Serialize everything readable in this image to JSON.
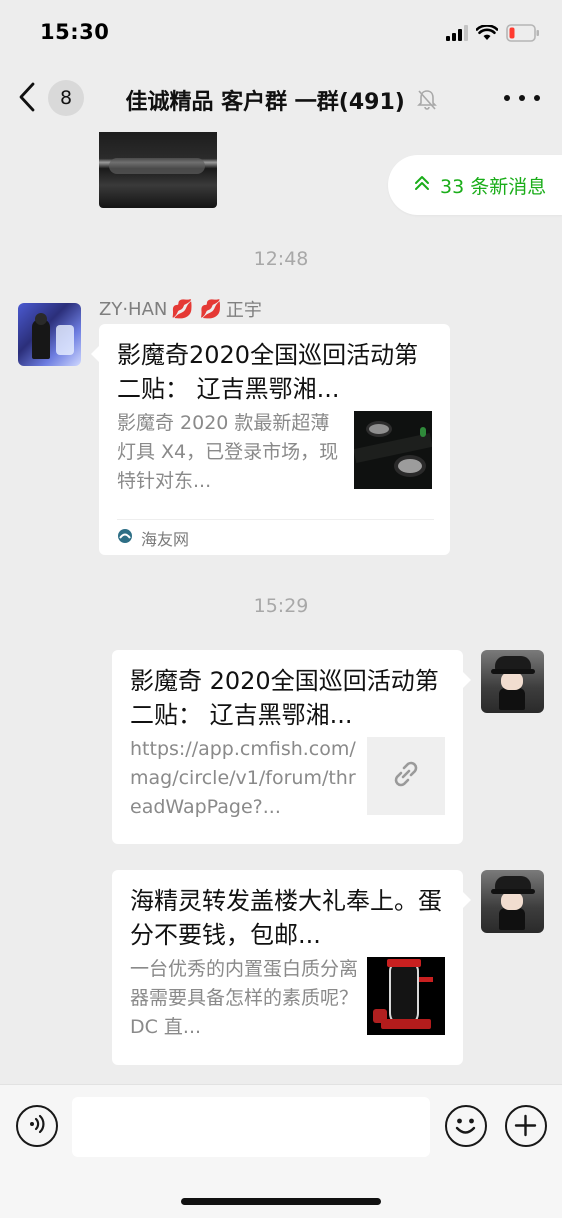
{
  "status_bar": {
    "time": "15:30",
    "icons": [
      "signal-icon",
      "wifi-icon",
      "battery-low-icon"
    ],
    "battery_color": "#ff3b30"
  },
  "nav": {
    "back_count": "8",
    "title": "佳诚精品 客户群 一群(491)",
    "icons": [
      "back-arrow-icon",
      "mute-bell-icon",
      "more-icon"
    ]
  },
  "new_messages": {
    "label": "33 条新消息",
    "icon": "double-chevron-up-icon",
    "color": "#1aad19"
  },
  "messages": {
    "time1": "12:48",
    "time2": "15:29",
    "msg1": {
      "sender_prefix": "ZY·HAN",
      "sender_emoji": "💋 💋",
      "sender_suffix": "正宇",
      "title": "影魔奇2020全国巡回活动第二贴： 辽吉黑鄂湘...",
      "description": "影魔奇 2020 款最新超薄灯具 X4，已登录市场，现特针对东...",
      "source": "海友网",
      "thumb": "aquarium-light-image"
    },
    "msg2": {
      "title": "影魔奇 2020全国巡回活动第二贴： 辽吉黑鄂湘...",
      "description": "https://app.cmfish.com/mag/circle/v1/forum/threadWapPage?...",
      "thumb": "link-icon"
    },
    "msg3": {
      "title": "海精灵转发盖楼大礼奉上。蛋分不要钱，包邮...",
      "description": "一台优秀的内置蛋白质分离器需要具备怎样的素质呢？DC 直...",
      "thumb": "protein-skimmer-image"
    }
  },
  "input_bar": {
    "icons": [
      "voice-icon",
      "emoji-icon",
      "plus-icon"
    ],
    "input_value": ""
  }
}
